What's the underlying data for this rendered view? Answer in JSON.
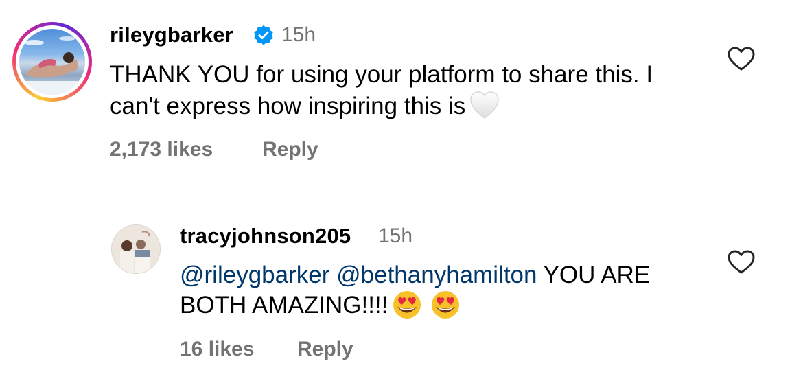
{
  "comments": [
    {
      "username": "rileygbarker",
      "verified": true,
      "time": "15h",
      "text": "THANK YOU for using your platform to share this. I can't express how inspiring this is",
      "trailing_emoji": "white-heart",
      "likes": "2,173 likes",
      "reply_label": "Reply"
    },
    {
      "username": "tracyjohnson205",
      "verified": false,
      "time": "15h",
      "mentions": [
        "@rileygbarker",
        "@bethanyhamilton"
      ],
      "text": "YOU ARE BOTH AMAZING!!!!",
      "trailing_emoji": [
        "heart-eyes",
        "heart-eyes"
      ],
      "likes": "16 likes",
      "reply_label": "Reply"
    }
  ],
  "colors": {
    "secondary_text": "#737373",
    "mention": "#00376b",
    "verified_badge": "#0095f6"
  }
}
